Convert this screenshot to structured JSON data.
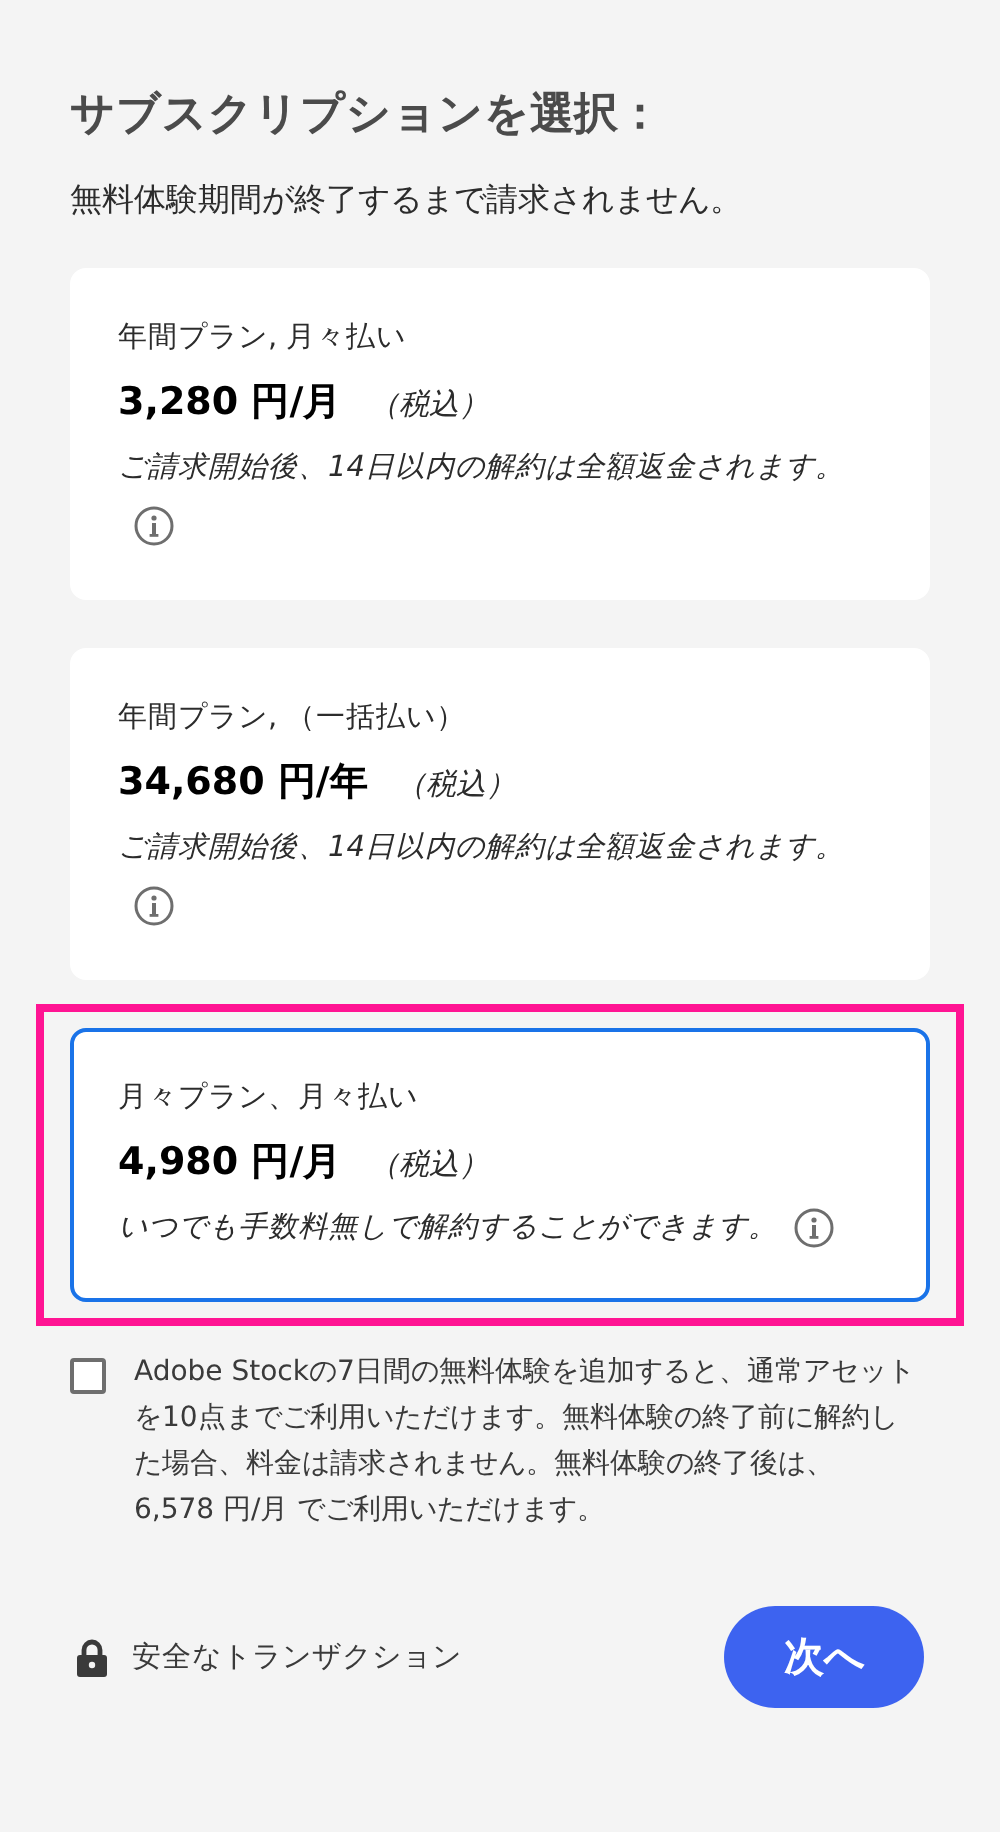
{
  "title": "サブスクリプションを選択：",
  "subtitle": "無料体験期間が終了するまで請求されません。",
  "plans": [
    {
      "name": "年間プラン, 月々払い",
      "price": "3,280 円/月",
      "tax": "（税込）",
      "note": "ご請求開始後、14日以内の解約は全額返金されます。",
      "selected": false
    },
    {
      "name": "年間プラン, （一括払い）",
      "price": "34,680 円/年",
      "tax": "（税込）",
      "note": "ご請求開始後、14日以内の解約は全額返金されます。",
      "selected": false
    },
    {
      "name": "月々プラン、月々払い",
      "price": "4,980 円/月",
      "tax": "（税込）",
      "note": "いつでも手数料無しで解約することができます。",
      "selected": true
    }
  ],
  "addon": {
    "checked": false,
    "label": "Adobe Stockの7日間の無料体験を追加すると、通常アセットを10点までご利用いただけます。無料体験の終了前に解約した場合、料金は請求されません。無料体験の終了後は、 6,578 円/月 でご利用いただけます。"
  },
  "secure_label": "安全なトランザクション",
  "next_button": "次へ"
}
